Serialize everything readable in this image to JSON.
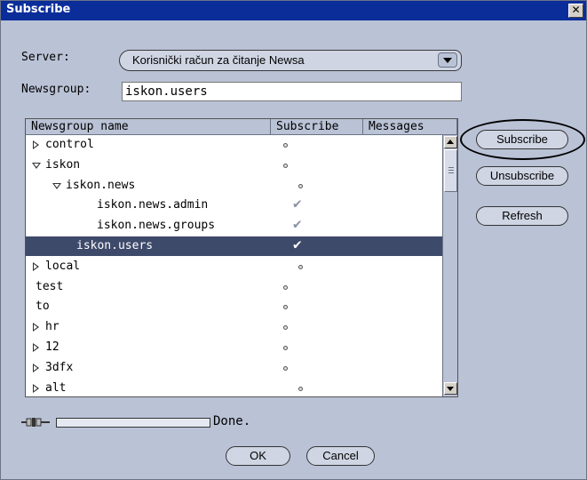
{
  "window": {
    "title": "Subscribe",
    "close_label": "✕"
  },
  "form": {
    "server_label": "Server:",
    "server_value": "Korisnički račun za čitanje Newsa",
    "newsgroup_label": "Newsgroup:",
    "newsgroup_value": "iskon.users"
  },
  "table": {
    "columns": [
      "Newsgroup name",
      "Subscribe",
      "Messages"
    ],
    "rows": [
      {
        "name": "control",
        "expand": "collapsed",
        "subscribed": false
      },
      {
        "name": "iskon",
        "expand": "expanded",
        "subscribed": false
      },
      {
        "name": "iskon.news",
        "expand": "expanded",
        "subscribed": false
      },
      {
        "name": "iskon.news.admin",
        "expand": "none",
        "subscribed": true
      },
      {
        "name": "iskon.news.groups",
        "expand": "none",
        "subscribed": true
      },
      {
        "name": "iskon.users",
        "expand": "none",
        "subscribed": true,
        "selected": true
      },
      {
        "name": "local",
        "expand": "collapsed",
        "subscribed": false
      },
      {
        "name": "test",
        "expand": "none",
        "subscribed": false
      },
      {
        "name": "to",
        "expand": "none",
        "subscribed": false
      },
      {
        "name": "hr",
        "expand": "collapsed",
        "subscribed": false
      },
      {
        "name": "12",
        "expand": "collapsed",
        "subscribed": false
      },
      {
        "name": "3dfx",
        "expand": "collapsed",
        "subscribed": false
      },
      {
        "name": "alt",
        "expand": "collapsed",
        "subscribed": false
      }
    ]
  },
  "buttons": {
    "subscribe": "Subscribe",
    "unsubscribe": "Unsubscribe",
    "refresh": "Refresh",
    "ok": "OK",
    "cancel": "Cancel"
  },
  "status": {
    "text": "Done.",
    "progress": 0
  },
  "colors": {
    "titlebar": "#0b2d9a",
    "window_bg": "#bac2d6",
    "selection": "#3e4a6a"
  }
}
